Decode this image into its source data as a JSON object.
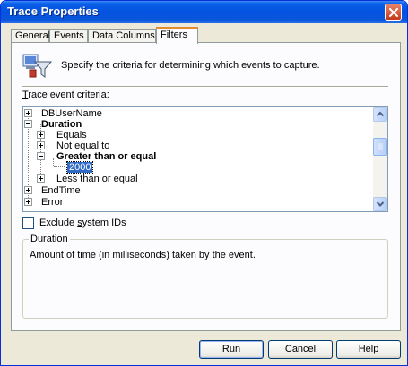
{
  "window": {
    "title": "Trace Properties"
  },
  "tabs": [
    {
      "label": "General"
    },
    {
      "label": "Events"
    },
    {
      "label": "Data Columns"
    },
    {
      "label": "Filters"
    }
  ],
  "active_tab": "Filters",
  "header": {
    "description": "Specify the criteria for determining which events to capture.",
    "icon": "trace-filter-icon"
  },
  "criteria": {
    "label_prefix": "",
    "label_hotkey": "T",
    "label_rest": "race event criteria:",
    "tree": [
      {
        "label": "DBUserName",
        "expander": "+",
        "bold": false
      },
      {
        "label": "Duration",
        "expander": "-",
        "bold": true
      },
      {
        "label": "Equals",
        "expander": "+",
        "bold": false
      },
      {
        "label": "Not equal to",
        "expander": "+",
        "bold": false
      },
      {
        "label": "Greater than or equal",
        "expander": "-",
        "bold": true
      },
      {
        "label": "2000",
        "expander": "",
        "bold": false,
        "selected": true
      },
      {
        "label": "Less than or equal",
        "expander": "+",
        "bold": false
      },
      {
        "label": "EndTime",
        "expander": "+",
        "bold": false
      },
      {
        "label": "Error",
        "expander": "+",
        "bold": false
      }
    ],
    "scroll_position": 0.3
  },
  "exclude": {
    "prefix": "Exclude ",
    "hotkey": "s",
    "rest": "ystem IDs",
    "checked": false
  },
  "details": {
    "title": "Duration",
    "description": "Amount of time (in milliseconds) taken by the event."
  },
  "buttons": {
    "run": "Run",
    "cancel": "Cancel",
    "help": "Help"
  },
  "colors": {
    "titlebar": "#0453e0",
    "selection": "#316ac5",
    "tab_accent": "#e68b2c"
  }
}
